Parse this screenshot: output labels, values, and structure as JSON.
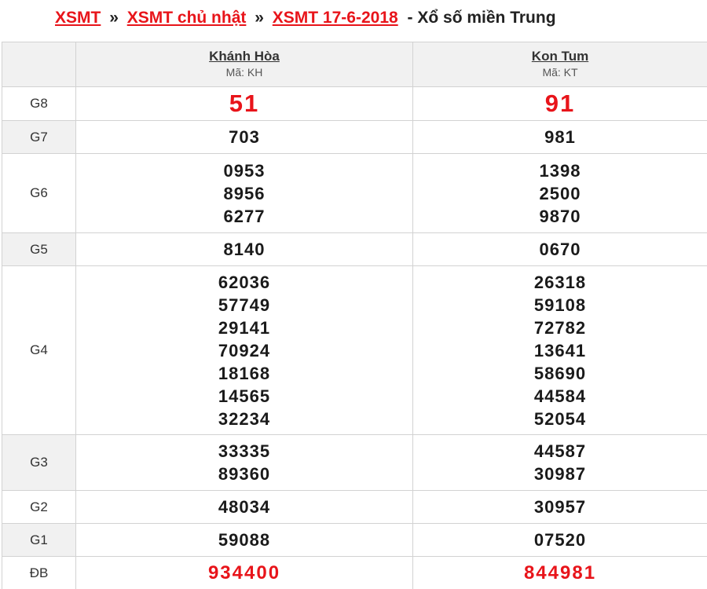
{
  "breadcrumb": {
    "link1": "XSMT",
    "sep1": "»",
    "link2": "XSMT chủ nhật",
    "sep2": "»",
    "link3": "XSMT 17-6-2018",
    "tail": "- Xổ số miền Trung"
  },
  "provinces": [
    {
      "name": "Khánh Hòa",
      "code": "Mã: KH"
    },
    {
      "name": "Kon Tum",
      "code": "Mã: KT"
    }
  ],
  "prizes": [
    {
      "label": "G8",
      "values": [
        [
          "51"
        ],
        [
          "91"
        ]
      ]
    },
    {
      "label": "G7",
      "values": [
        [
          "703"
        ],
        [
          "981"
        ]
      ]
    },
    {
      "label": "G6",
      "values": [
        [
          "0953",
          "8956",
          "6277"
        ],
        [
          "1398",
          "2500",
          "9870"
        ]
      ]
    },
    {
      "label": "G5",
      "values": [
        [
          "8140"
        ],
        [
          "0670"
        ]
      ]
    },
    {
      "label": "G4",
      "values": [
        [
          "62036",
          "57749",
          "29141",
          "70924",
          "18168",
          "14565",
          "32234"
        ],
        [
          "26318",
          "59108",
          "72782",
          "13641",
          "58690",
          "44584",
          "52054"
        ]
      ]
    },
    {
      "label": "G3",
      "values": [
        [
          "33335",
          "89360"
        ],
        [
          "44587",
          "30987"
        ]
      ]
    },
    {
      "label": "G2",
      "values": [
        [
          "48034"
        ],
        [
          "30957"
        ]
      ]
    },
    {
      "label": "G1",
      "values": [
        [
          "59088"
        ],
        [
          "07520"
        ]
      ]
    },
    {
      "label": "ĐB",
      "values": [
        [
          "934400"
        ],
        [
          "844981"
        ]
      ]
    }
  ],
  "colors": {
    "accent_red": "#e8141a",
    "row_alt_bg": "#f1f1f1",
    "border": "#d2d2d2"
  }
}
